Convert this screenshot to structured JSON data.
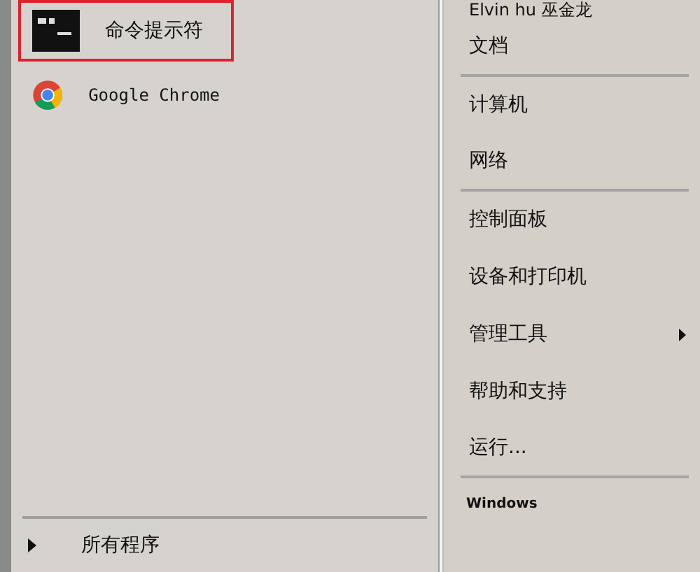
{
  "pinned_programs": [
    {
      "label": "命令提示符",
      "kind": "console",
      "selected": true
    },
    {
      "label": "Google Chrome",
      "kind": "browser",
      "selected": false
    }
  ],
  "all_programs": {
    "label": "所有程序"
  },
  "user_name": "Elvin hu 巫金龙",
  "places": [
    {
      "label": "文档",
      "submenu": false,
      "separator_after": true
    },
    {
      "label": "计算机",
      "submenu": false,
      "separator_after": false
    },
    {
      "label": "网络",
      "submenu": false,
      "separator_after": true
    },
    {
      "label": "控制面板",
      "submenu": false,
      "separator_after": false
    },
    {
      "label": "设备和打印机",
      "submenu": false,
      "separator_after": false
    },
    {
      "label": "管理工具",
      "submenu": true,
      "separator_after": false
    },
    {
      "label": "帮助和支持",
      "submenu": false,
      "separator_after": false
    },
    {
      "label": "运行...",
      "submenu": false,
      "separator_after": true
    }
  ],
  "shutdown": {
    "label": "Windows"
  }
}
